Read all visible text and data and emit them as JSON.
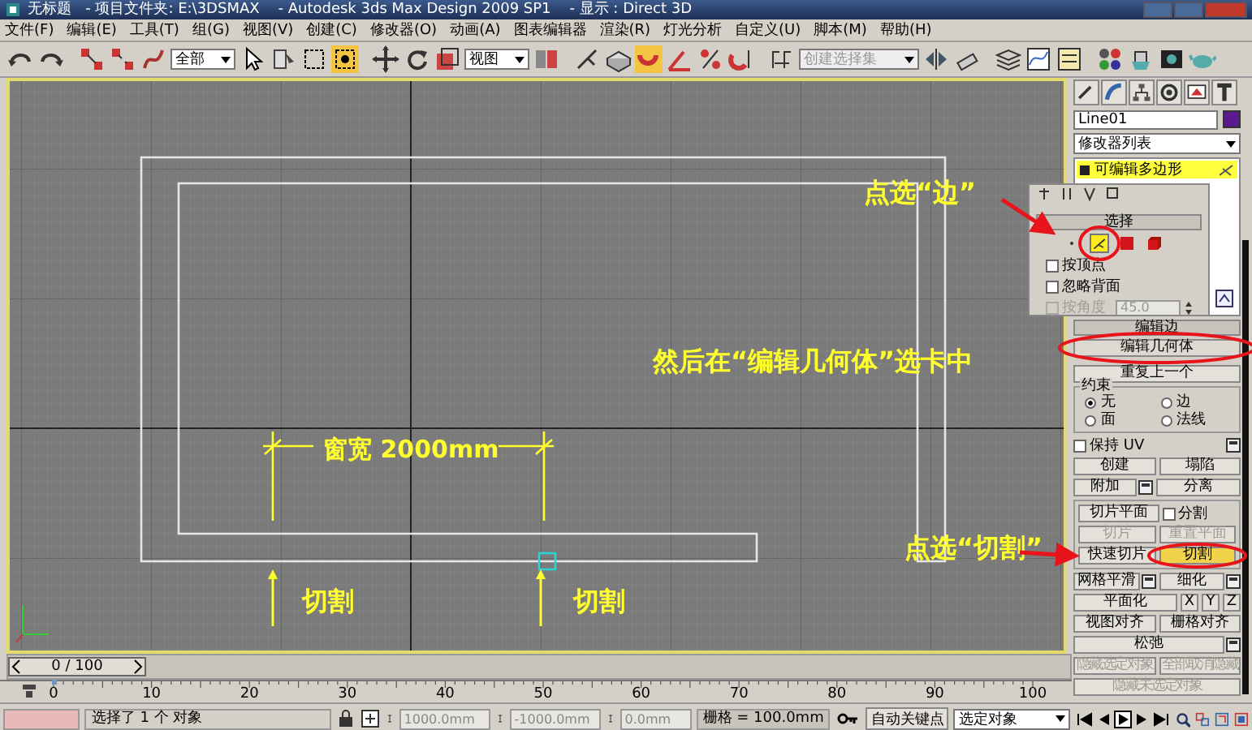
{
  "window": {
    "title": "无标题   - 项目文件夹: E:\\3DSMAX    - Autodesk 3ds Max Design 2009 SP1    - 显示 : Direct 3D"
  },
  "menu": [
    "文件(F)",
    "编辑(E)",
    "工具(T)",
    "组(G)",
    "视图(V)",
    "创建(C)",
    "修改器(O)",
    "动画(A)",
    "图表编辑器",
    "渲染(R)",
    "灯光分析",
    "自定义(U)",
    "脚本(M)",
    "帮助(H)"
  ],
  "toolbar": {
    "selection_filter": "全部",
    "coordinate_system": "视图",
    "named_selection": {
      "placeholder": "创建选择集"
    }
  },
  "viewport": {
    "callouts": [
      "点选“边”",
      "然后在“编辑几何体”选卡中",
      "点选“切割”"
    ],
    "dimension": "窗宽 2000mm",
    "cut_marks": [
      "切割",
      "切割"
    ]
  },
  "command_panel": {
    "object_name": "Line01",
    "modifier_list": "修改器列表",
    "stack": [
      {
        "label": "可编辑多边形",
        "selected": true
      }
    ],
    "edit_edges": "编辑边",
    "edit_geometry": {
      "title": "编辑几何体",
      "repeat_last": "重复上一个",
      "constraints": {
        "title": "约束",
        "options": [
          {
            "label": "无",
            "selected": true
          },
          {
            "label": "边",
            "selected": false
          },
          {
            "label": "面",
            "selected": false
          },
          {
            "label": "法线",
            "selected": false
          }
        ]
      },
      "preserve_uv": {
        "label": "保持 UV",
        "checked": false
      },
      "rows": [
        [
          {
            "kind": "button",
            "label": "创建",
            "disabled": false,
            "on": false
          },
          {
            "kind": "button",
            "label": "塌陷",
            "disabled": false,
            "on": false
          }
        ],
        [
          {
            "kind": "button_with_settings",
            "label": "附加",
            "disabled": false,
            "on": false
          },
          {
            "kind": "button",
            "label": "分离",
            "disabled": false,
            "on": false
          }
        ]
      ],
      "slice_rows": [
        [
          {
            "kind": "button",
            "label": "切片平面",
            "disabled": false,
            "on": false
          },
          {
            "kind": "checkbox",
            "label": "分割",
            "checked": false
          }
        ],
        [
          {
            "kind": "button",
            "label": "切片",
            "disabled": true,
            "on": false
          },
          {
            "kind": "button",
            "label": "重置平面",
            "disabled": true,
            "on": false
          }
        ],
        [
          {
            "kind": "button",
            "label": "快速切片",
            "disabled": false,
            "on": false
          },
          {
            "kind": "button",
            "label": "切割",
            "disabled": false,
            "on": true
          }
        ]
      ],
      "more_rows": [
        [
          {
            "kind": "button_with_settings",
            "label": "网格平滑",
            "disabled": false,
            "on": false
          },
          {
            "kind": "button_with_settings",
            "label": "细化",
            "disabled": false,
            "on": false
          }
        ],
        [
          {
            "kind": "button",
            "label": "平面化",
            "disabled": false,
            "on": false
          },
          {
            "kind": "axis_button",
            "label": "X",
            "disabled": false,
            "on": false
          },
          {
            "kind": "axis_button",
            "label": "Y",
            "disabled": false,
            "on": false
          },
          {
            "kind": "axis_button",
            "label": "Z",
            "disabled": false,
            "on": false
          }
        ],
        [
          {
            "kind": "button",
            "label": "视图对齐",
            "disabled": false,
            "on": false
          },
          {
            "kind": "button",
            "label": "栅格对齐",
            "disabled": false,
            "on": false
          }
        ],
        [
          {
            "kind": "button_with_settings",
            "label": "松弛",
            "disabled": false,
            "on": false
          }
        ],
        [
          {
            "kind": "button",
            "label": "隐藏选定对象",
            "disabled": true,
            "on": false
          },
          {
            "kind": "button",
            "label": "全部取消隐藏",
            "disabled": true,
            "on": false
          }
        ],
        [
          {
            "kind": "button",
            "label": "隐藏未选定对象",
            "disabled": true,
            "on": false
          }
        ]
      ]
    }
  },
  "selection_rollout": {
    "title": "选择",
    "subobjects": [
      {
        "kind": "vertex",
        "selected": false
      },
      {
        "kind": "edge",
        "selected": true
      },
      {
        "kind": "polygon",
        "selected": false
      },
      {
        "kind": "element",
        "selected": false
      }
    ],
    "options": [
      {
        "label": "按顶点",
        "checked": false,
        "disabled": false
      },
      {
        "label": "忽略背面",
        "checked": false,
        "disabled": false
      },
      {
        "label": "按角度",
        "checked": false,
        "disabled": true
      }
    ],
    "angle": "45.0"
  },
  "time_slider": {
    "label": "0 / 100"
  },
  "ruler_labels": [
    "0",
    "10",
    "20",
    "30",
    "40",
    "50",
    "60",
    "70",
    "80",
    "90",
    "100"
  ],
  "status_bar": {
    "prompt": "选择了 1 个 对象",
    "x": "1000.0mm",
    "y": "-1000.0mm",
    "z": "0.0mm",
    "grid": "栅格 = 100.0mm",
    "auto_key": "自动关键点",
    "key_filter": "选定对象"
  }
}
